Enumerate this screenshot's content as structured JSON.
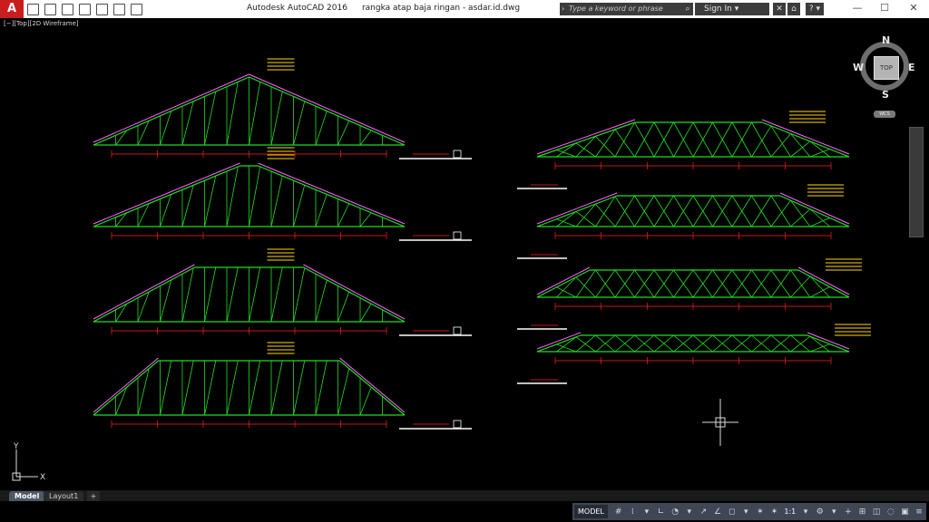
{
  "titlebar": {
    "app_name": "Autodesk AutoCAD 2016",
    "document_name": "rangka atap baja ringan - asdar.id.dwg",
    "search_placeholder": "Type a keyword or phrase",
    "sign_in": "Sign In"
  },
  "viewport": {
    "label": "[−][Top][2D Wireframe]"
  },
  "viewcube": {
    "face": "TOP",
    "north": "N",
    "south": "S",
    "east": "E",
    "west": "W",
    "wcs": "WCS"
  },
  "ucs": {
    "x": "X",
    "y": "Y"
  },
  "drawing": {
    "truss_count": 8,
    "dimension_color": "#ff2020",
    "chord_color": "#22dd22",
    "web_color": "#22dd22",
    "rafter_color": "#ff66ff",
    "annotation_color": "#ffd800"
  },
  "layout_tabs": {
    "model": "Model",
    "layout1": "Layout1",
    "add": "+"
  },
  "status_bar": {
    "model_label": "MODEL",
    "scale": "1:1"
  },
  "colors": {
    "canvas": "#000000",
    "titlebar": "#ffffff",
    "status_strip": "#3f4654",
    "app_button": "#c81e1e"
  }
}
